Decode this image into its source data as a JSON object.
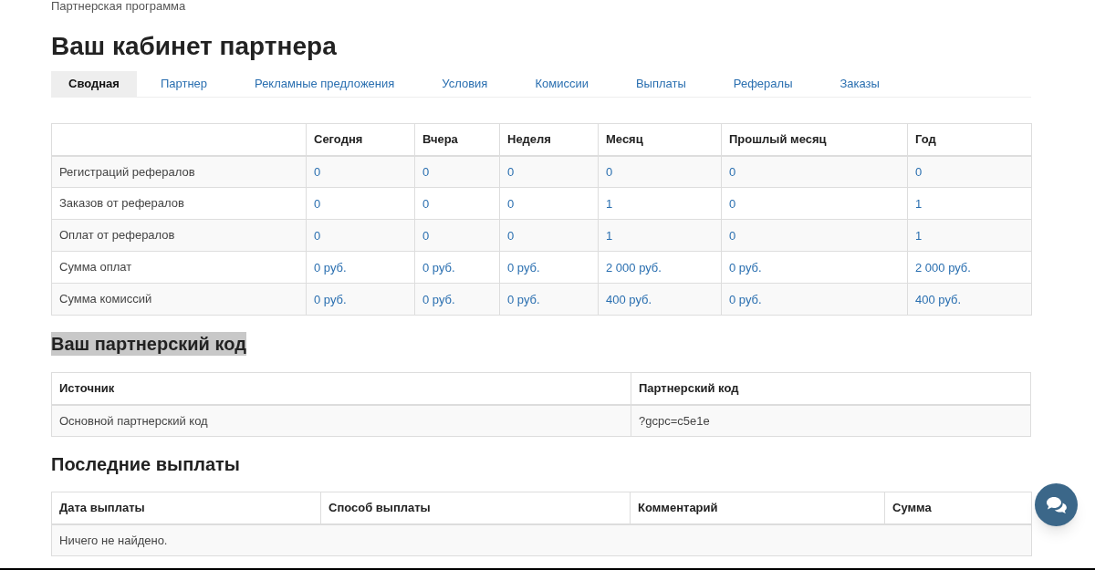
{
  "breadcrumb": "Партнерская программа",
  "title": "Ваш кабинет партнера",
  "tabs": [
    {
      "label": "Сводная",
      "selected": true
    },
    {
      "label": "Партнер",
      "selected": false
    },
    {
      "label": "Рекламные предложения",
      "selected": false
    },
    {
      "label": "Условия",
      "selected": false
    },
    {
      "label": "Комиссии",
      "selected": false
    },
    {
      "label": "Выплаты",
      "selected": false
    },
    {
      "label": "Рефералы",
      "selected": false
    },
    {
      "label": "Заказы",
      "selected": false
    }
  ],
  "stats_table": {
    "columns": [
      "Сегодня",
      "Вчера",
      "Неделя",
      "Месяц",
      "Прошлый месяц",
      "Год"
    ],
    "rows": [
      {
        "label": "Регистраций рефералов",
        "cells": [
          "0",
          "0",
          "0",
          "0",
          "0",
          "0"
        ]
      },
      {
        "label": "Заказов от рефералов",
        "cells": [
          "0",
          "0",
          "0",
          "1",
          "0",
          "1"
        ]
      },
      {
        "label": "Оплат от рефералов",
        "cells": [
          "0",
          "0",
          "0",
          "1",
          "0",
          "1"
        ]
      },
      {
        "label": "Сумма оплат",
        "cells": [
          "0 руб.",
          "0 руб.",
          "0 руб.",
          "2 000 руб.",
          "0 руб.",
          "2 000 руб."
        ]
      },
      {
        "label": "Сумма комиссий",
        "cells": [
          "0 руб.",
          "0 руб.",
          "0 руб.",
          "400 руб.",
          "0 руб.",
          "400 руб."
        ]
      }
    ]
  },
  "code_section": {
    "heading": "Ваш партнерский код",
    "highlighted": true,
    "columns": [
      "Источник",
      "Партнерский код"
    ],
    "rows": [
      [
        "Основной партнерский код",
        "?gcpc=c5e1e"
      ]
    ]
  },
  "payments_section": {
    "heading": "Последние выплаты",
    "columns": [
      "Дата выплаты",
      "Способ выплаты",
      "Комментарий",
      "Сумма"
    ],
    "empty_text": "Ничего не найдено."
  }
}
